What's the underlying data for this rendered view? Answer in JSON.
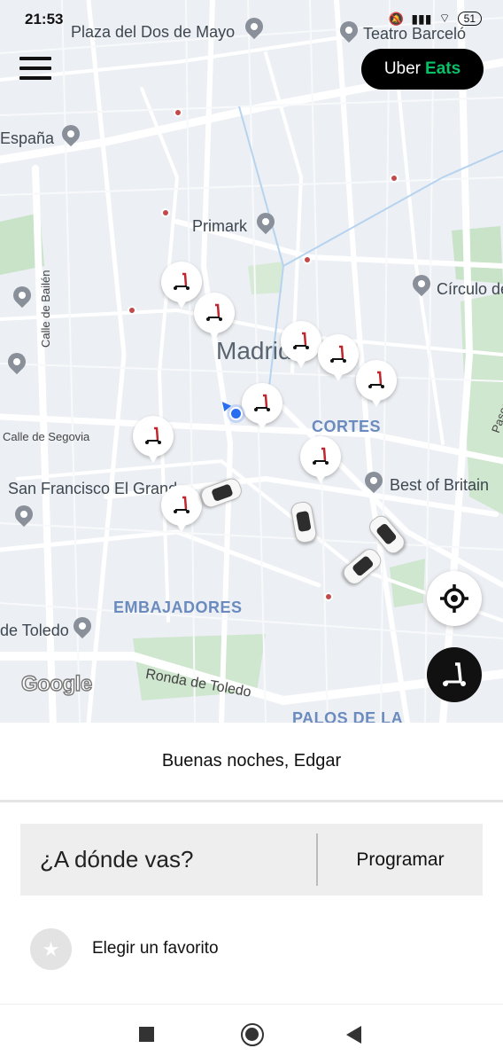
{
  "status_bar": {
    "time": "21:53",
    "battery": "51"
  },
  "header": {
    "eats_button": {
      "part1": "Uber",
      "part2": "Eats"
    }
  },
  "map": {
    "labels": {
      "plaza_dos_de_mayo": "Plaza del Dos de Mayo",
      "teatro_barcelo": "Teatro Barceló",
      "espana": "España",
      "primark": "Primark",
      "circulo": "Círculo de",
      "calle_bailen": "Calle de Bailén",
      "madrid": "Madrid",
      "cortes": "CORTES",
      "paseo_prado": "Paseo del Prado",
      "calle_segovia": "Calle de Segovia",
      "san_francisco": "San Francisco El Grande",
      "best_of_britain": "Best of Britain",
      "embajadores": "EMBAJADORES",
      "toledo": "de Toledo",
      "ronda_toledo": "Ronda de Toledo",
      "palos": "PALOS DE LA",
      "google": "Google"
    }
  },
  "sheet": {
    "greeting": "Buenas noches, Edgar",
    "where_placeholder": "¿A dónde vas?",
    "schedule_label": "Programar",
    "favorite_label": "Elegir un favorito"
  },
  "colors": {
    "accent_blue": "#276ef1",
    "eats_green": "#06c167",
    "scooter_red": "#c0262d"
  }
}
